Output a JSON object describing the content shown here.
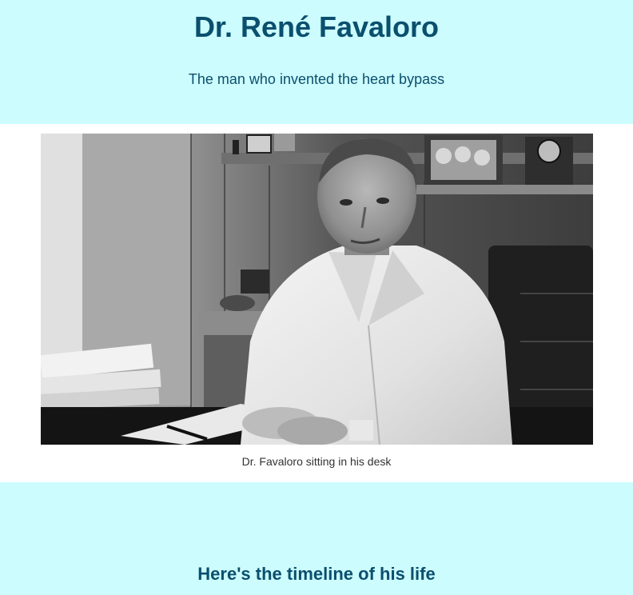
{
  "header": {
    "title": "Dr. René Favaloro",
    "subtitle": "The man who invented the heart bypass"
  },
  "photo": {
    "caption": "Dr. Favaloro sitting in his desk"
  },
  "timeline": {
    "heading": "Here's the timeline of his life"
  },
  "colors": {
    "section_background": "#ccfcfd",
    "heading_text": "#0b4f6e",
    "caption_text": "#333333"
  }
}
